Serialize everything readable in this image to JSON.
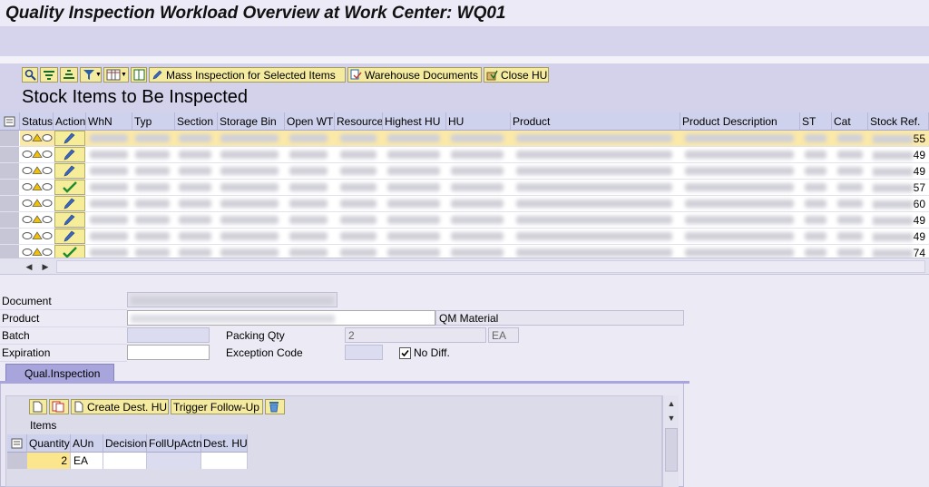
{
  "window": {
    "title": "Quality Inspection Workload Overview at Work Center: WQ01"
  },
  "toolbar": {
    "mass_inspection_label": "Mass Inspection for Selected Items",
    "warehouse_documents_label": "Warehouse Documents",
    "close_hu_label": "Close HU"
  },
  "stock_section": {
    "title": "Stock Items to Be Inspected",
    "columns": [
      "Status",
      "Action",
      "WhN",
      "Typ",
      "Section",
      "Storage Bin",
      "Open WT",
      "Resource",
      "Highest HU",
      "HU",
      "Product",
      "Product Description",
      "ST",
      "Cat",
      "Stock Ref."
    ],
    "stock_ref_suffixes": [
      "55",
      "49",
      "49",
      "57",
      "60",
      "49",
      "49",
      "74"
    ],
    "row_actions": [
      "edit",
      "edit",
      "edit",
      "done",
      "edit",
      "edit",
      "edit",
      "done"
    ]
  },
  "details": {
    "document_label": "Document",
    "product_label": "Product",
    "product_description": "QM Material",
    "batch_label": "Batch",
    "expiration_label": "Expiration",
    "packing_qty_label": "Packing Qty",
    "packing_qty_value": "2",
    "packing_qty_unit": "EA",
    "exception_code_label": "Exception Code",
    "no_diff_label": "No Diff."
  },
  "tabs": {
    "qual_inspection": "Qual.Inspection"
  },
  "qi_toolbar": {
    "create_dest_hu_label": "Create Dest. HU",
    "trigger_followup_label": "Trigger Follow-Up"
  },
  "items": {
    "title": "Items",
    "columns": [
      "Quantity",
      "AUn",
      "Decision",
      "FollUpActn",
      "Dest. HU"
    ],
    "rows": [
      {
        "quantity": "2",
        "aun": "EA",
        "decision": "",
        "follupactn": "",
        "dest_hu": ""
      }
    ]
  },
  "colors": {
    "toolbar_button_bg": "#f4eba0",
    "selected_row": "#fbe9a9",
    "tab_bg": "#a7a5dc"
  }
}
